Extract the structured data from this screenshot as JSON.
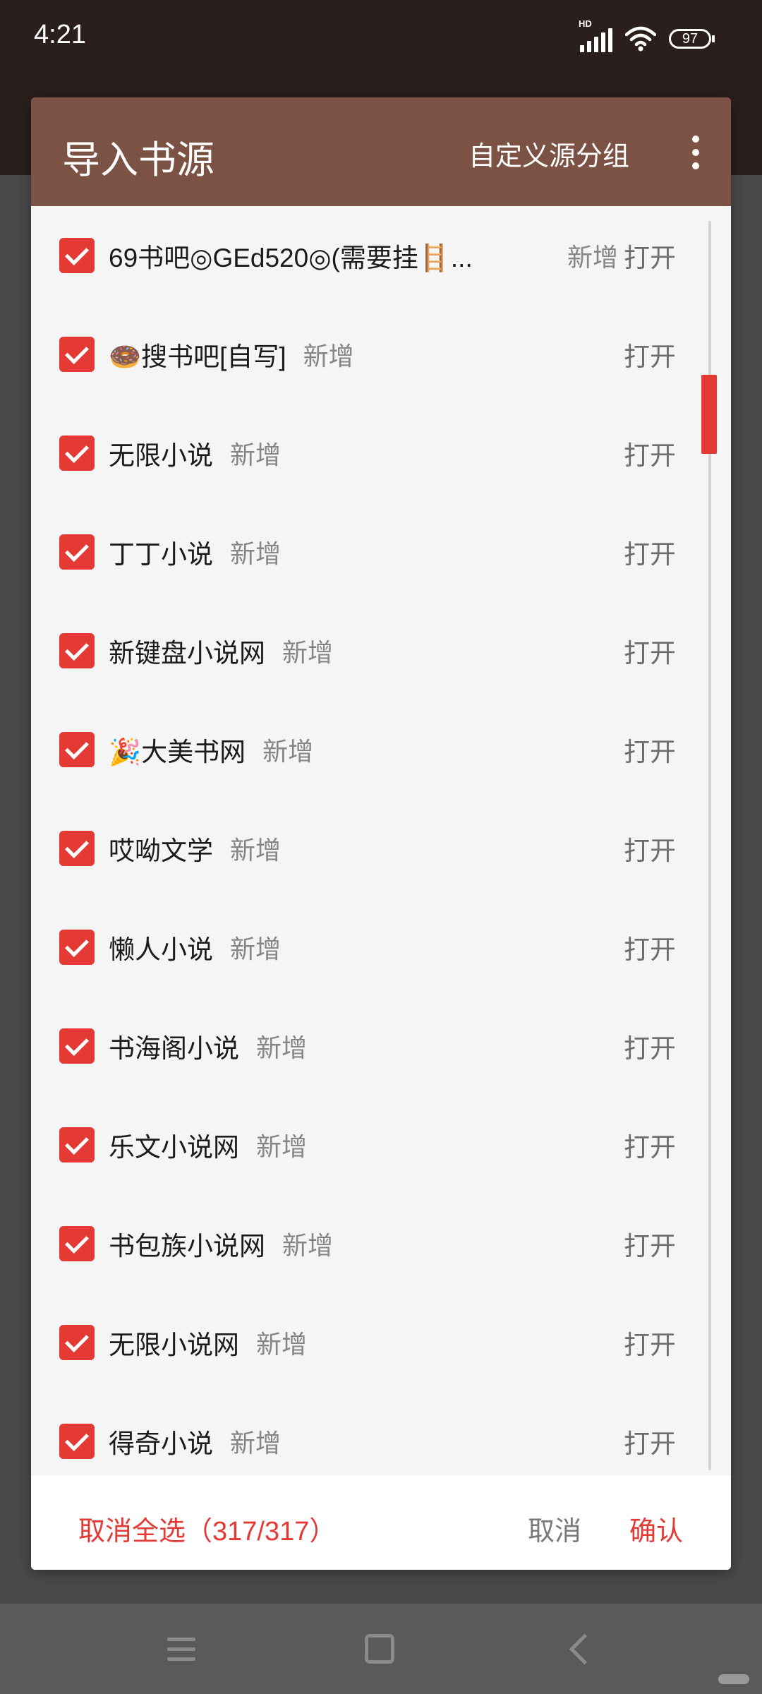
{
  "status_bar": {
    "time": "4:21",
    "network": "HD",
    "battery": "97",
    "icons": [
      "signal-icon",
      "wifi-icon",
      "battery-icon"
    ]
  },
  "dialog": {
    "title": "导入书源",
    "group_button": "自定义源分组",
    "more_icon": "more-vertical-icon",
    "items": [
      {
        "name": "69书吧◎GEd520◎(需要挂🪜...",
        "tag": "新增",
        "action": "打开",
        "checked": true
      },
      {
        "name": "🍩搜书吧[自写]",
        "tag": "新增",
        "action": "打开",
        "checked": true
      },
      {
        "name": "无限小说",
        "tag": "新增",
        "action": "打开",
        "checked": true
      },
      {
        "name": "丁丁小说",
        "tag": "新增",
        "action": "打开",
        "checked": true
      },
      {
        "name": "新键盘小说网",
        "tag": "新增",
        "action": "打开",
        "checked": true
      },
      {
        "name": "🎉大美书网",
        "tag": "新增",
        "action": "打开",
        "checked": true
      },
      {
        "name": "哎呦文学",
        "tag": "新增",
        "action": "打开",
        "checked": true
      },
      {
        "name": "懒人小说",
        "tag": "新增",
        "action": "打开",
        "checked": true
      },
      {
        "name": "书海阁小说",
        "tag": "新增",
        "action": "打开",
        "checked": true
      },
      {
        "name": "乐文小说网",
        "tag": "新增",
        "action": "打开",
        "checked": true
      },
      {
        "name": "书包族小说网",
        "tag": "新增",
        "action": "打开",
        "checked": true
      },
      {
        "name": "无限小说网",
        "tag": "新增",
        "action": "打开",
        "checked": true
      },
      {
        "name": "得奇小说",
        "tag": "新增",
        "action": "打开",
        "checked": true
      }
    ],
    "footer": {
      "unselect_all": "取消全选（317/317）",
      "cancel": "取消",
      "confirm": "确认"
    }
  },
  "colors": {
    "header": "#7b5244",
    "accent": "#e53935",
    "status_bar": "#2b1f1d"
  }
}
